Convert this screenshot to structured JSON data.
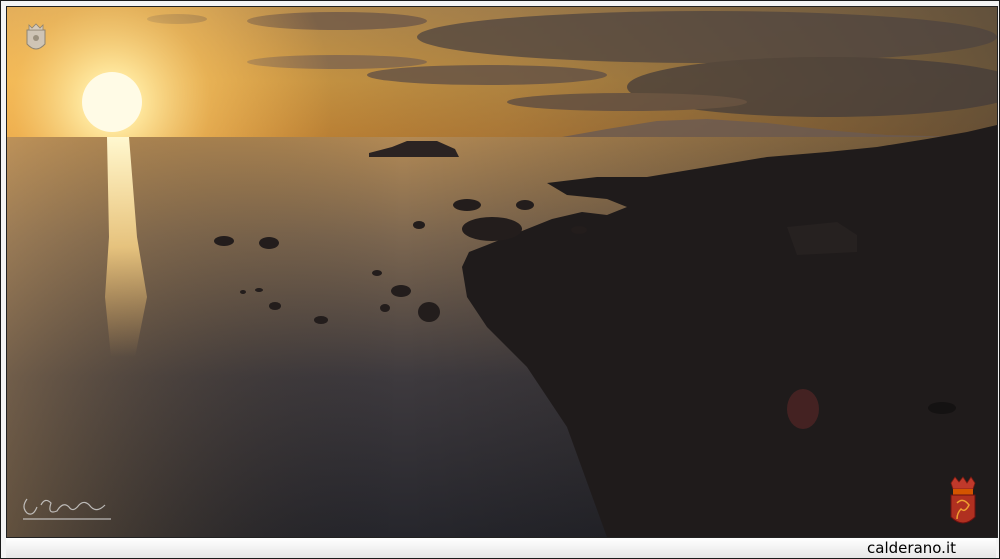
{
  "footer": {
    "site_label": "calderano.it"
  },
  "colors": {
    "sky_top": "#4a4240",
    "sky_glow": "#f2b24a",
    "sun": "#fff6c8",
    "sea": "#2a2a30",
    "land_silhouette": "#1d1a19",
    "crest_red": "#c0392b"
  },
  "watermarks": {
    "top_left": "crest-emblem",
    "bottom_left": "handwritten-signature",
    "bottom_right": "heraldic-crest"
  }
}
